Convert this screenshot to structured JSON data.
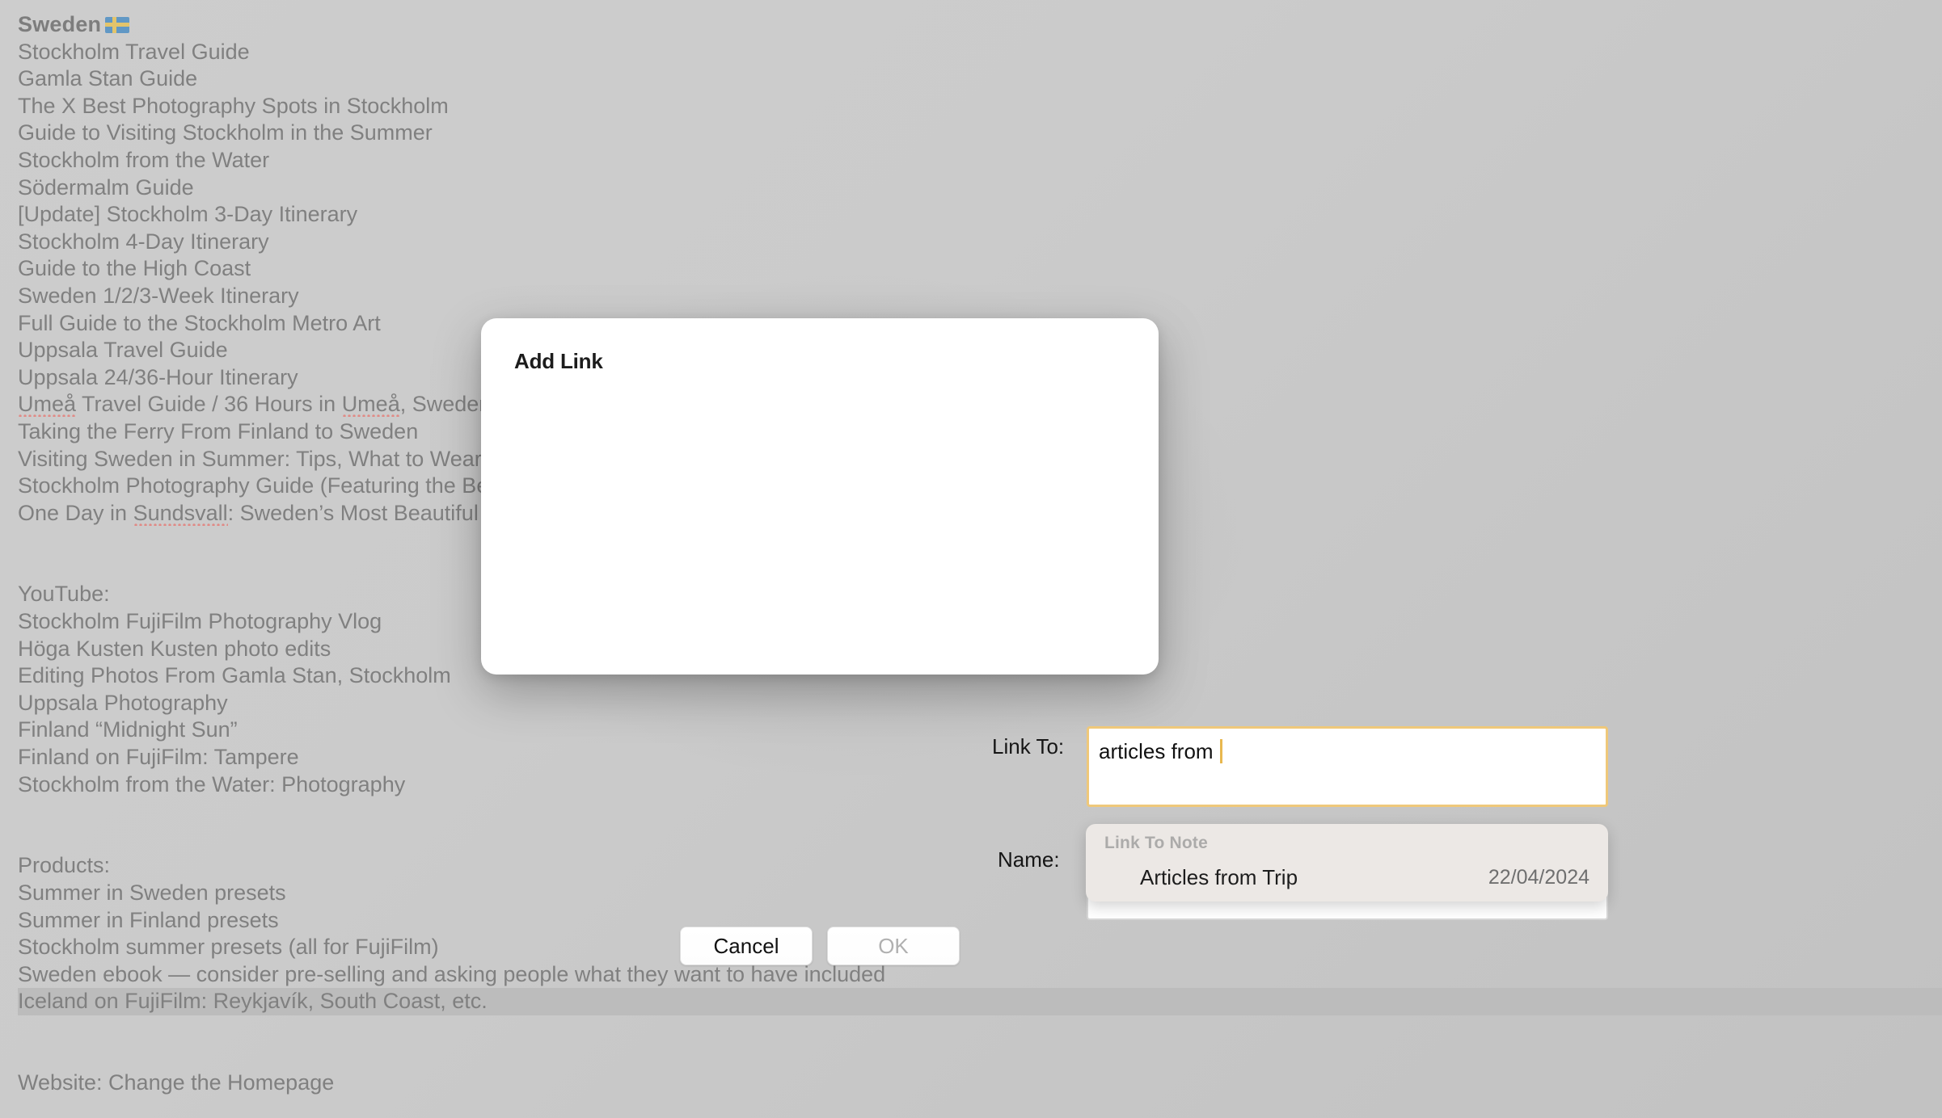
{
  "note": {
    "heading": "Sweden",
    "heading_icon": "sweden-flag-emoji",
    "lines": [
      "Stockholm Travel Guide",
      "Gamla Stan Guide",
      "The X Best Photography Spots in Stockholm",
      "Guide to Visiting Stockholm in the Summer",
      "Stockholm from the Water",
      "Södermalm Guide",
      "[Update] Stockholm 3-Day Itinerary",
      "Stockholm 4-Day Itinerary",
      "Guide to the High Coast",
      "Sweden 1/2/3-Week Itinerary",
      "Full Guide to the Stockholm Metro Art",
      "Uppsala Travel Guide",
      "Uppsala 24/36-Hour Itinerary"
    ],
    "line_umea_a": "Umeå",
    "line_umea_b": " Travel Guide / 36 Hours in ",
    "line_umea_c": "Umeå",
    "line_umea_d": ", Sweden",
    "lines2": [
      "Taking the Ferry From Finland to Sweden",
      "Visiting Sweden in Summer: Tips, What to Wear",
      "Stockholm Photography Guide (Featuring the Best Spots)"
    ],
    "line_sundsvall_a": "One Day in ",
    "line_sundsvall_b": "Sundsvall",
    "line_sundsvall_c": ": Sweden’s Most Beautiful",
    "youtube_heading": "YouTube:",
    "youtube_lines": [
      "Stockholm FujiFilm Photography Vlog",
      "Höga Kusten Kusten photo edits",
      "Editing Photos From Gamla Stan, Stockholm",
      "Uppsala Photography",
      "Finland “Midnight Sun”",
      "Finland on FujiFilm: Tampere",
      "Stockholm from the Water: Photography"
    ],
    "products_heading": "Products:",
    "products_lines": [
      "Summer in Sweden presets",
      "Summer in Finland presets",
      "Stockholm summer presets (all for FujiFilm)",
      "Sweden ebook — consider pre-selling and asking people what they want to have included"
    ],
    "products_selected_line": "Iceland on FujiFilm: Reykjavík, South Coast, etc.",
    "footer_line": "Website: Change the Homepage"
  },
  "dialog": {
    "title": "Add Link",
    "link_to_label": "Link To:",
    "link_to_value": "articles from ",
    "link_to_placeholder": "",
    "name_label": "Name:",
    "name_value": "",
    "name_placeholder": "",
    "cancel_label": "Cancel",
    "ok_label": "OK"
  },
  "autocomplete": {
    "header": "Link To Note",
    "items": [
      {
        "name": "Articles from Trip",
        "date": "22/04/2024"
      }
    ]
  },
  "colors": {
    "focus_border": "#EFC87A",
    "caret": "#E8B84F",
    "popup_bg": "#ECE8E5",
    "selection_highlight": "#BCBCBC",
    "backdrop": "#CACACA",
    "note_text": "#808080",
    "spellcheck_underline": "#E08A86"
  }
}
